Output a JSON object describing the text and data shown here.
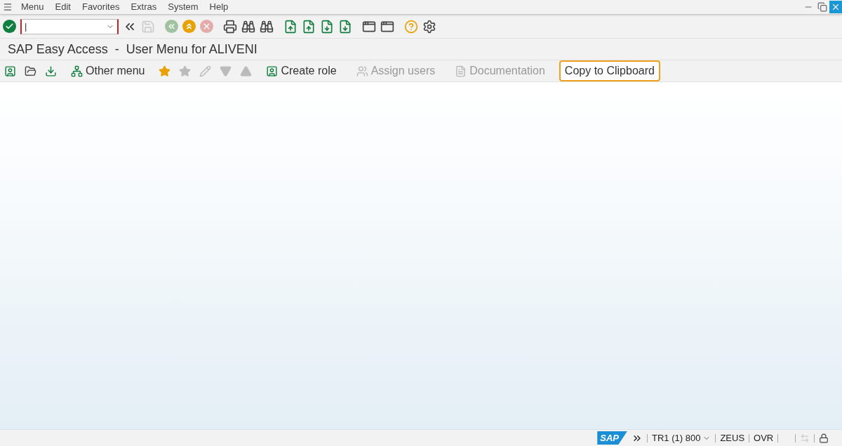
{
  "menu_bar": [
    "Menu",
    "Edit",
    "Favorites",
    "Extras",
    "System",
    "Help"
  ],
  "standard_toolbar": {
    "command_field": {
      "value": "|"
    },
    "buttons": [
      {
        "disabled": false
      },
      {
        "disabled": false
      },
      {
        "disabled": true
      },
      {
        "disabled": true
      },
      {
        "disabled": false
      },
      {
        "disabled": true
      },
      {
        "disabled": false
      },
      {
        "disabled": false
      },
      {
        "disabled": false
      },
      {
        "disabled": false
      },
      {
        "disabled": false
      },
      {
        "disabled": false
      },
      {
        "disabled": false
      },
      {
        "disabled": false
      },
      {
        "disabled": false
      },
      {
        "disabled": false
      },
      {
        "disabled": false
      }
    ]
  },
  "title": "SAP Easy Access  -  User Menu for ALIVENI",
  "application_toolbar": [
    {
      "kind": "icon",
      "disabled": false
    },
    {
      "kind": "icon",
      "disabled": false
    },
    {
      "kind": "icon",
      "disabled": false
    },
    {
      "kind": "labeled",
      "label": "Other menu",
      "disabled": false,
      "highlighted": false
    },
    {
      "kind": "icon",
      "disabled": false
    },
    {
      "kind": "icon",
      "disabled": true
    },
    {
      "kind": "icon",
      "disabled": true
    },
    {
      "kind": "icon",
      "disabled": true
    },
    {
      "kind": "icon",
      "disabled": true
    },
    {
      "kind": "labeled",
      "label": "Create role",
      "disabled": false,
      "highlighted": false
    },
    {
      "kind": "labeled",
      "label": "Assign users",
      "disabled": true,
      "highlighted": false
    },
    {
      "kind": "labeled",
      "label": "Documentation",
      "disabled": true,
      "highlighted": false
    },
    {
      "kind": "labeled",
      "label": "Copy to Clipboard",
      "disabled": false,
      "highlighted": true
    }
  ],
  "status_bar": {
    "logo": "SAP",
    "system": "TR1 (1) 800",
    "server": "ZEUS",
    "mode": "OVR"
  }
}
